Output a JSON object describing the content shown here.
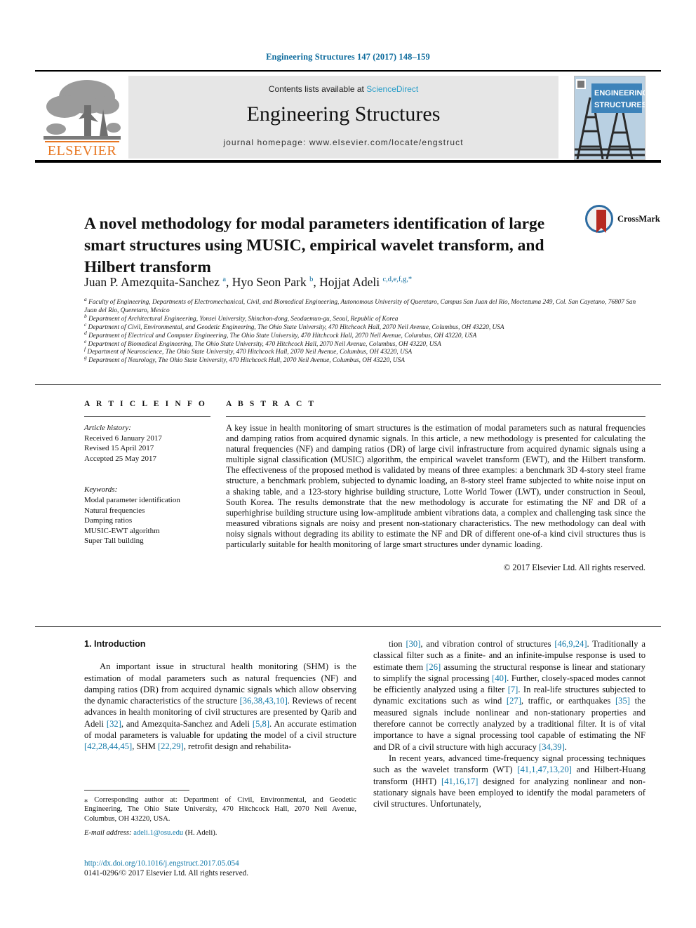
{
  "running_head": "Engineering Structures 147 (2017) 148–159",
  "masthead": {
    "contents_prefix": "Contents lists available at ",
    "sciencedirect": "ScienceDirect",
    "journal_title": "Engineering Structures",
    "homepage": "journal homepage: www.elsevier.com/locate/engstruct",
    "publisher_wordmark": "ELSEVIER",
    "cover_line1": "ENGINEERING",
    "cover_line2": "STRUCTURES",
    "accent_orange": "#E87722",
    "accent_blue": "#2a9ec9"
  },
  "article": {
    "title": "A novel methodology for modal parameters identification of large smart structures using MUSIC, empirical wavelet transform, and Hilbert transform",
    "crossmark_label": "CrossMark",
    "authors_html": "Juan P. Amezquita-Sanchez <sup>a</sup>, Hyo Seon Park <sup>b</sup>, Hojjat Adeli <sup>c,d,e,f,g,*</sup>",
    "affiliations": [
      {
        "mark": "a",
        "text": "Faculty of Engineering, Departments of Electromechanical, Civil, and Biomedical Engineering, Autonomous University of Queretaro, Campus San Juan del Rio, Moctezuma 249, Col. San Cayetano, 76807 San Juan del Rio, Queretaro, Mexico"
      },
      {
        "mark": "b",
        "text": "Department of Architectural Engineering, Yonsei University, Shinchon-dong, Seodaemun-gu, Seoul, Republic of Korea"
      },
      {
        "mark": "c",
        "text": "Department of Civil, Environmental, and Geodetic Engineering, The Ohio State University, 470 Hitchcock Hall, 2070 Neil Avenue, Columbus, OH 43220, USA"
      },
      {
        "mark": "d",
        "text": "Department of Electrical and Computer Engineering, The Ohio State University, 470 Hitchcock Hall, 2070 Neil Avenue, Columbus, OH 43220, USA"
      },
      {
        "mark": "e",
        "text": "Department of Biomedical Engineering, The Ohio State University, 470 Hitchcock Hall, 2070 Neil Avenue, Columbus, OH 43220, USA"
      },
      {
        "mark": "f",
        "text": "Department of Neuroscience, The Ohio State University, 470 Hitchcock Hall, 2070 Neil Avenue, Columbus, OH 43220, USA"
      },
      {
        "mark": "g",
        "text": "Department of Neurology, The Ohio State University, 470 Hitchcock Hall, 2070 Neil Avenue, Columbus, OH 43220, USA"
      }
    ]
  },
  "article_info": {
    "heading": "A R T I C L E  I N F O",
    "history_label": "Article history:",
    "history": [
      "Received 6 January 2017",
      "Revised 15 April 2017",
      "Accepted 25 May 2017"
    ],
    "keywords_label": "Keywords:",
    "keywords": [
      "Modal parameter identification",
      "Natural frequencies",
      "Damping ratios",
      "MUSIC-EWT algorithm",
      "Super Tall building"
    ]
  },
  "abstract": {
    "heading": "A B S T R A C T",
    "text": "A key issue in health monitoring of smart structures is the estimation of modal parameters such as natural frequencies and damping ratios from acquired dynamic signals. In this article, a new methodology is presented for calculating the natural frequencies (NF) and damping ratios (DR) of large civil infrastructure from acquired dynamic signals using a multiple signal classification (MUSIC) algorithm, the empirical wavelet transform (EWT), and the Hilbert transform. The effectiveness of the proposed method is validated by means of three examples: a benchmark 3D 4-story steel frame structure, a benchmark problem, subjected to dynamic loading, an 8-story steel frame subjected to white noise input on a shaking table, and a 123-story highrise building structure, Lotte World Tower (LWT), under construction in Seoul, South Korea. The results demonstrate that the new methodology is accurate for estimating the NF and DR of a superhighrise building structure using low-amplitude ambient vibrations data, a complex and challenging task since the measured vibrations signals are noisy and present non-stationary characteristics. The new methodology can deal with noisy signals without degrading its ability to estimate the NF and DR of different one-of-a kind civil structures thus is particularly suitable for health monitoring of large smart structures under dynamic loading.",
    "copyright": "© 2017 Elsevier Ltd. All rights reserved."
  },
  "body": {
    "section_number_title": "1. Introduction",
    "left_paragraphs": [
      "An important issue in structural health monitoring (SHM) is the estimation of modal parameters such as natural frequencies (NF) and damping ratios (DR) from acquired dynamic signals which allow observing the dynamic characteristics of the structure [36,38,43,10]. Reviews of recent advances in health monitoring of civil structures are presented by Qarib and Adeli [32], and Amezquita-Sanchez and Adeli [5,8]. An accurate estimation of modal parameters is valuable for updating the model of a civil structure [42,28,44,45], SHM [22,29], retrofit design and rehabilita-"
    ],
    "right_paragraphs": [
      "tion [30], and vibration control of structures [46,9,24]. Traditionally a classical filter such as a finite- and an infinite-impulse response is used to estimate them [26] assuming the structural response is linear and stationary to simplify the signal processing [40]. Further, closely-spaced modes cannot be efficiently analyzed using a filter [7]. In real-life structures subjected to dynamic excitations such as wind [27], traffic, or earthquakes [35] the measured signals include nonlinear and non-stationary properties and therefore cannot be correctly analyzed by a traditional filter. It is of vital importance to have a signal processing tool capable of estimating the NF and DR of a civil structure with high accuracy [34,39].",
      "In recent years, advanced time-frequency signal processing techniques such as the wavelet transform (WT) [41,1,47,13,20] and Hilbert-Huang transform (HHT) [41,16,17] designed for analyzing nonlinear and non-stationary signals have been employed to identify the modal parameters of civil structures. Unfortunately,"
    ]
  },
  "footnote": {
    "star": "⁎",
    "corresponding": "Corresponding author at: Department of Civil, Environmental, and Geodetic Engineering, The Ohio State University, 470 Hitchcock Hall, 2070 Neil Avenue, Columbus, OH 43220, USA.",
    "email_label": "E-mail address:",
    "email": "adeli.1@osu.edu",
    "email_owner": "(H. Adeli)."
  },
  "doi_block": {
    "doi_url": "http://dx.doi.org/10.1016/j.engstruct.2017.05.054",
    "issn_line": "0141-0296/© 2017 Elsevier Ltd. All rights reserved."
  }
}
